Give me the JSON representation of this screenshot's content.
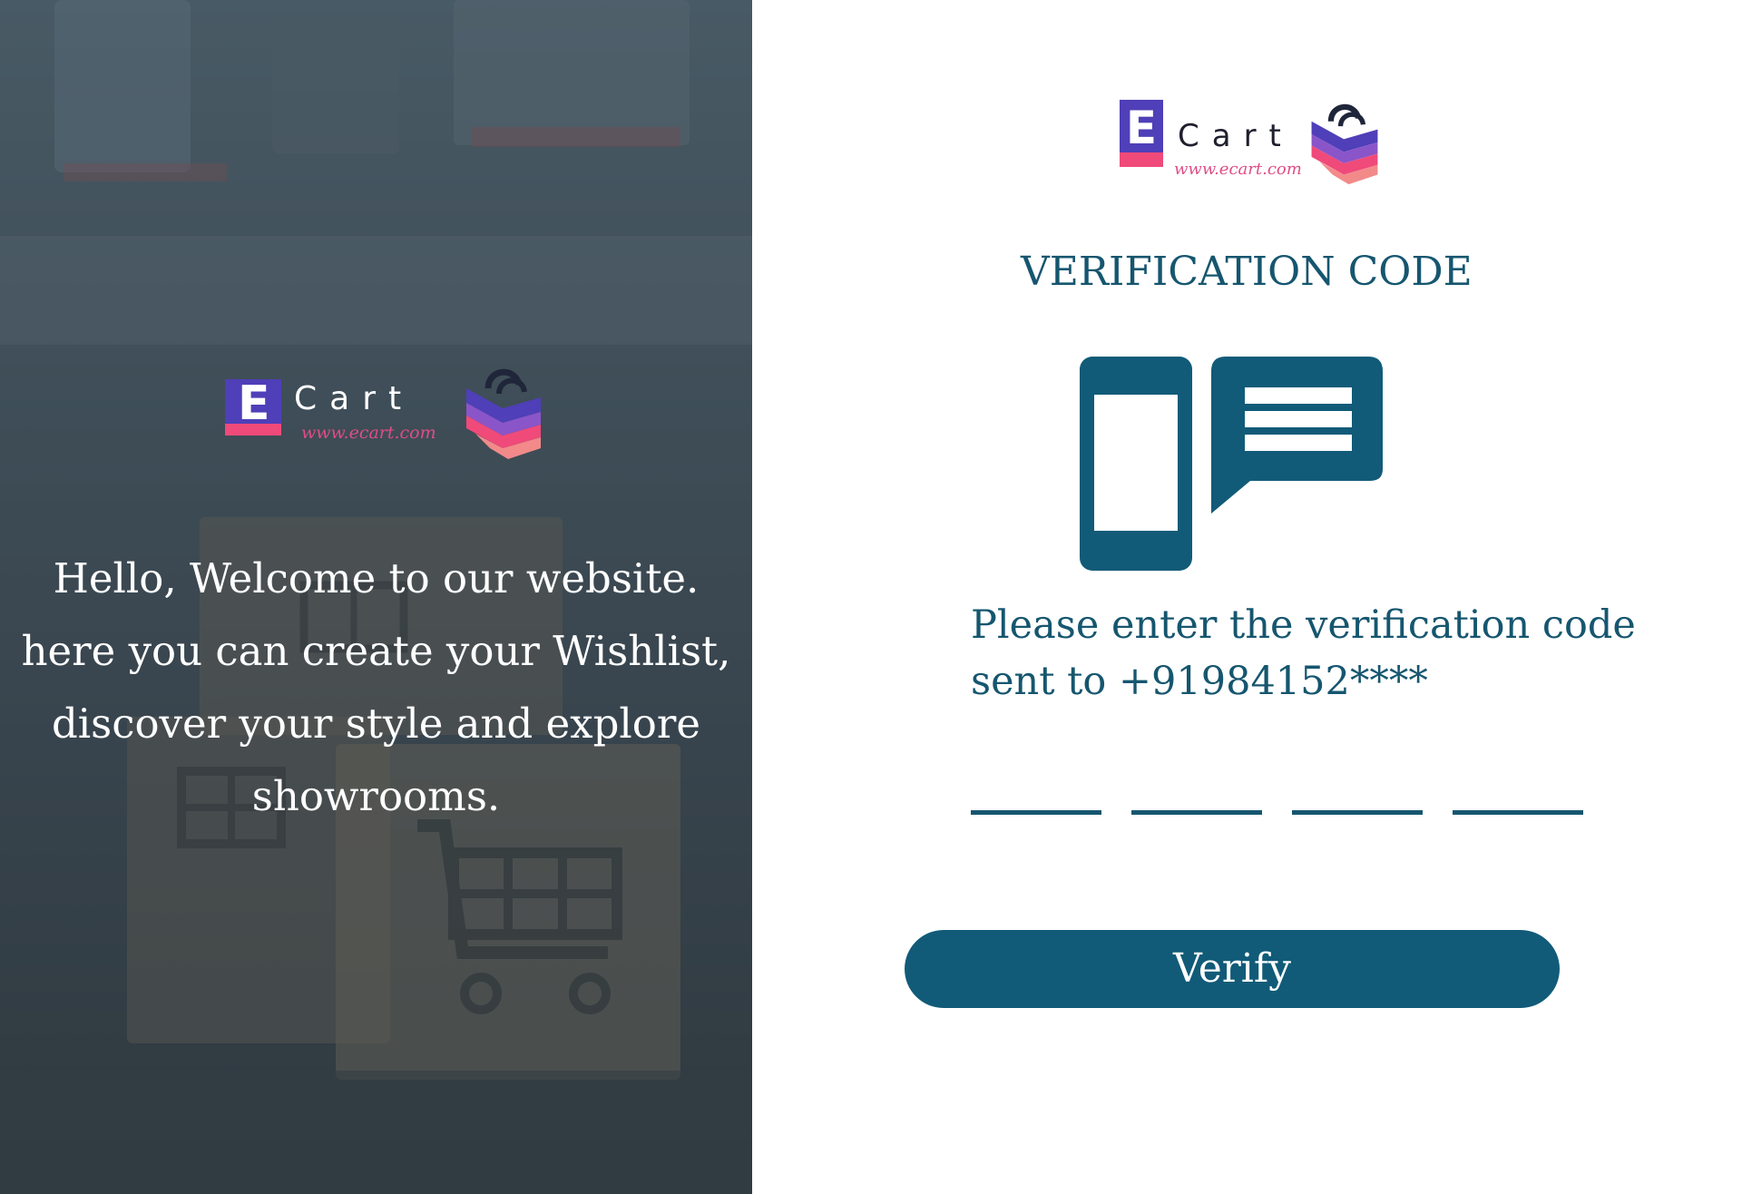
{
  "brand": {
    "letter": "E",
    "name": "Cart",
    "url": "www.ecart.com",
    "colors": {
      "primary": "#115b78",
      "logo_purple": "#4f3fb8",
      "logo_pink": "#ef4a7a",
      "logo_url_pink": "#e04d86"
    }
  },
  "left_panel": {
    "welcome_text": "Hello, Welcome to our website. here you can create your Wishlist, discover your style and explore showrooms."
  },
  "right_panel": {
    "title": "VERIFICATION CODE",
    "illustration_icon": "phone-sms-icon",
    "instruction_line1": "Please enter the verification code",
    "instruction_line2": "sent to +91984152****",
    "code_digits": [
      "",
      "",
      "",
      ""
    ],
    "verify_label": "Verify"
  }
}
